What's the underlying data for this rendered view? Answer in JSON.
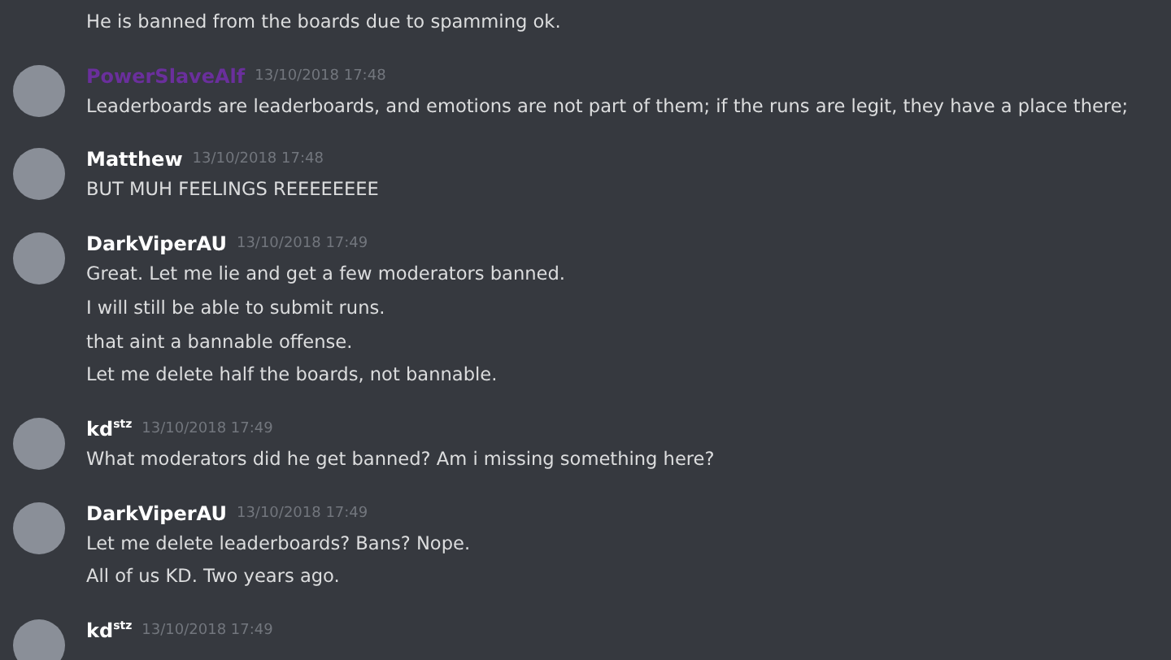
{
  "messages": [
    {
      "kind": "continuation",
      "lines": [
        "He is banned from the boards due to spamming ok."
      ]
    },
    {
      "kind": "group",
      "author": "PowerSlaveAlf",
      "color": "#6a2f9c",
      "time": "13/10/2018 17:48",
      "lines": [
        "Leaderboards are leaderboards, and emotions are not part of them; if the runs are legit, they have a place there;"
      ]
    },
    {
      "kind": "group",
      "author": "Matthew",
      "color": "#ffffff",
      "time": "13/10/2018 17:48",
      "lines": [
        "BUT MUH FEELINGS REEEEEEEE"
      ]
    },
    {
      "kind": "group",
      "author": "DarkViperAU",
      "color": "#ffffff",
      "time": "13/10/2018 17:49",
      "lines": [
        "Great. Let me lie and get a few moderators banned.",
        "I will still be able to submit runs.",
        "that aint a bannable offense.",
        "Let me delete half the boards, not bannable."
      ]
    },
    {
      "kind": "group",
      "author": "kd$^{stz}$",
      "color": "#ffffff",
      "time": "13/10/2018 17:49",
      "lines": [
        "What moderators did he get banned? Am i missing something here?"
      ]
    },
    {
      "kind": "group",
      "author": "DarkViperAU",
      "color": "#ffffff",
      "time": "13/10/2018 17:49",
      "lines": [
        "Let me delete leaderboards? Bans? Nope.",
        "All of us KD. Two years ago."
      ]
    },
    {
      "kind": "group",
      "author": "kd$^{stz}$",
      "color": "#ffffff",
      "time": "13/10/2018 17:49"
    }
  ]
}
